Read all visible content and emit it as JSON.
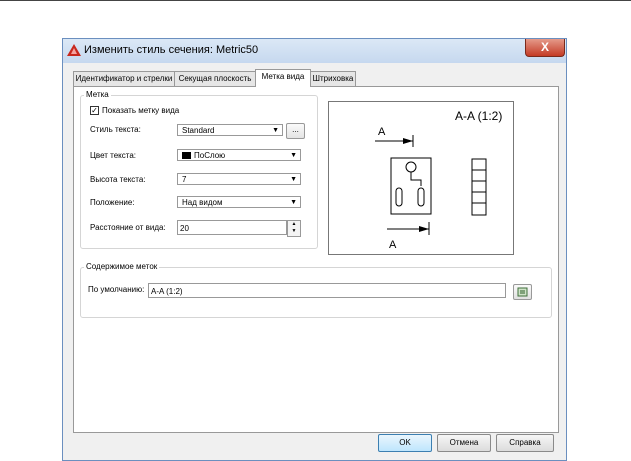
{
  "window": {
    "title": "Изменить стиль сечения: Metric50",
    "close_label": "X"
  },
  "tabs": [
    {
      "label": "Идентификатор и стрелки",
      "active": false
    },
    {
      "label": "Секущая плоскость",
      "active": false
    },
    {
      "label": "Метка вида",
      "active": true
    },
    {
      "label": "Штриховка",
      "active": false
    }
  ],
  "label_group": {
    "title": "Метка",
    "show_label": {
      "label": "Показать метку вида",
      "checked": true,
      "mark": "✓"
    },
    "text_style": {
      "label": "Стиль текста:",
      "value": "Standard",
      "browse_label": "..."
    },
    "text_color": {
      "label": "Цвет текста:",
      "value": "ПоСлою",
      "swatch": "#000000"
    },
    "text_height": {
      "label": "Высота текста:",
      "value": "7"
    },
    "position": {
      "label": "Положение:",
      "value": "Над видом"
    },
    "offset": {
      "label": "Расстояние от вида:",
      "value": "20"
    }
  },
  "preview": {
    "title": "A-A (1:2)",
    "top_letter": "A",
    "bottom_letter": "A"
  },
  "contents_group": {
    "title": "Содержимое меток",
    "default": {
      "label": "По умолчанию:",
      "value": "A-A (1:2)"
    }
  },
  "buttons": {
    "ok": "OK",
    "cancel": "Отмена",
    "help": "Справка"
  },
  "colors": {
    "accent": "#c43b25",
    "titlebar": "#c6d8ef"
  }
}
